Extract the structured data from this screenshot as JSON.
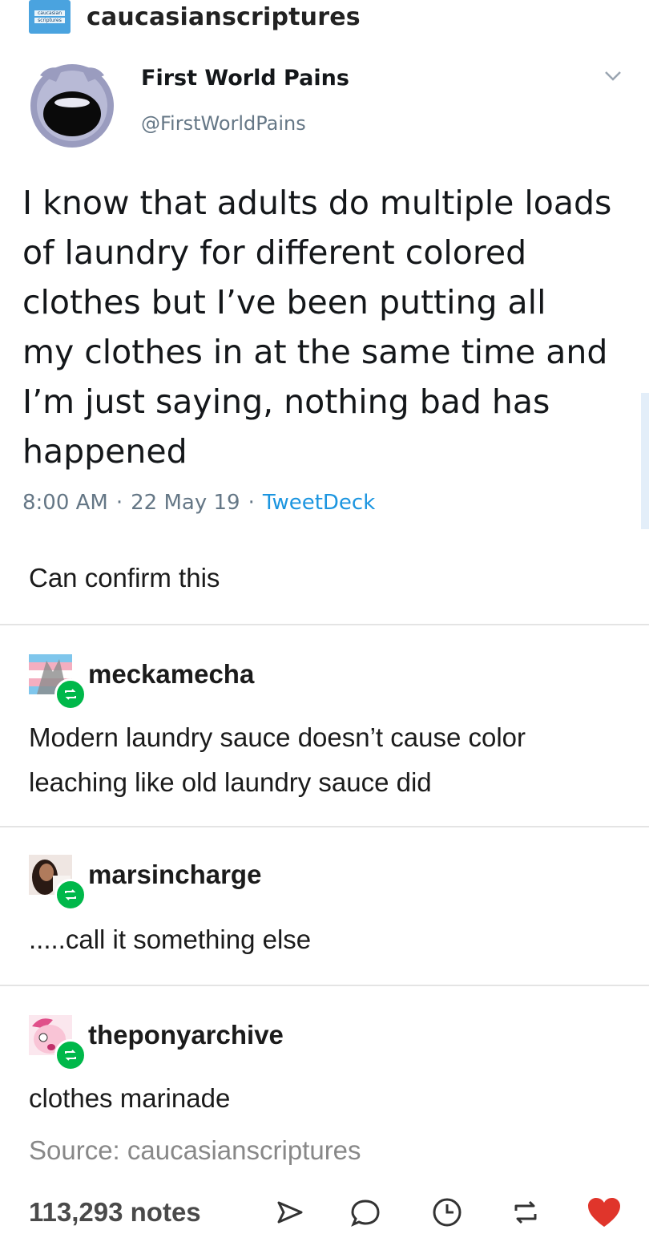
{
  "blog": {
    "avatar_text": [
      "caucasian",
      "scriptures"
    ],
    "name": "caucasianscriptures"
  },
  "tweet": {
    "author_name": "First World Pains",
    "handle": "@FirstWorldPains",
    "text_lines": [
      "I know that adults do multiple loads",
      "of laundry for different colored",
      "clothes but I’ve been putting all",
      "my clothes in at the same time and",
      "I’m just saying, nothing bad has",
      "happened"
    ],
    "time": "8:00 AM",
    "date": "22 May 19",
    "client": "TweetDeck",
    "separator": "·"
  },
  "op_comment": "Can confirm this",
  "reblogs": [
    {
      "username": "meckamecha",
      "lines": [
        "Modern laundry sauce doesn’t cause color",
        "leaching like old laundry sauce did"
      ]
    },
    {
      "username": "marsincharge",
      "lines": [
        ".....call it something else"
      ]
    },
    {
      "username": "theponyarchive",
      "lines": [
        "clothes marinade"
      ]
    }
  ],
  "source": "Source: caucasianscriptures",
  "footer": {
    "notes": "113,293 notes",
    "icons": [
      "share-icon",
      "reply-icon",
      "queue-icon",
      "reblog-icon",
      "like-icon"
    ],
    "like_color": "#e0352b"
  },
  "colors": {
    "tweet_link": "#1b95e0",
    "reblog_badge": "#00b84a"
  }
}
